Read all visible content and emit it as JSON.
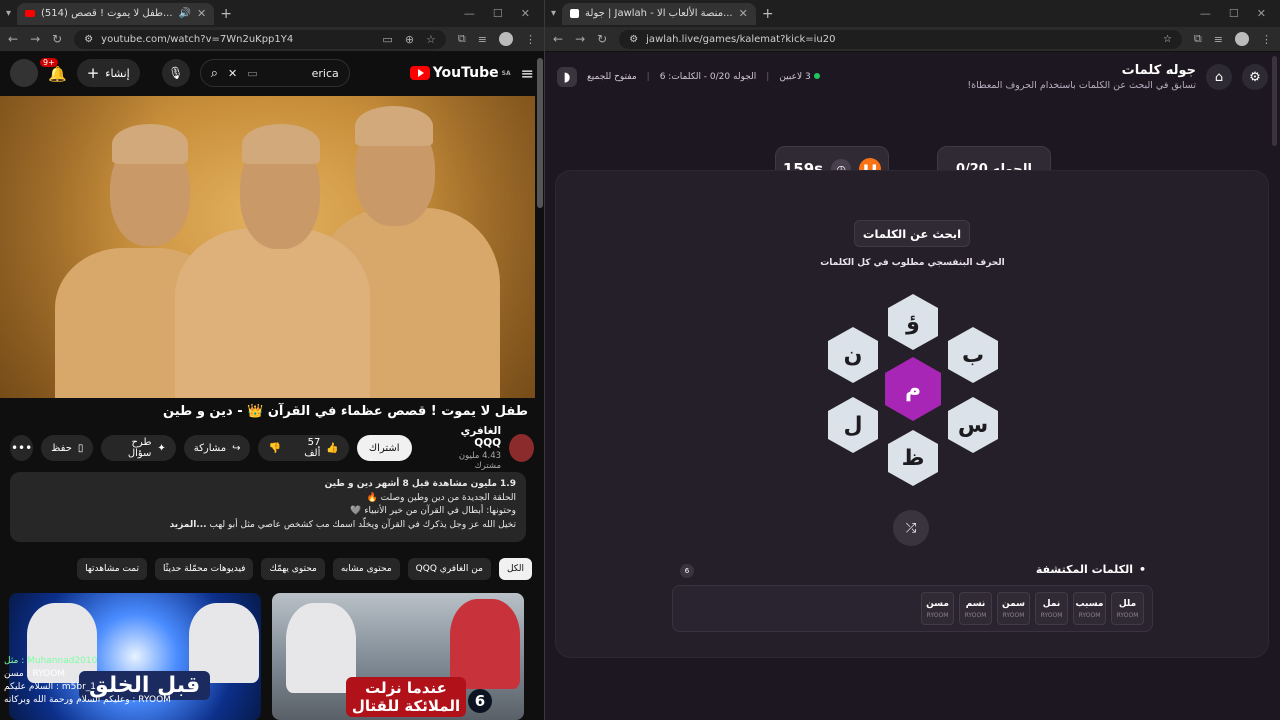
{
  "left_window": {
    "tab_title": "(514) طفل لا يموت ! قصص...",
    "url": "youtube.com/watch?v=7Wn2uKpp1Y4",
    "header": {
      "logo": "YouTube",
      "region": "SA",
      "search_value": "erica",
      "create_label": "إنشاء",
      "notif_count": "9+"
    },
    "video_title": "طفل لا يموت ! قصص عظماء في القرآن 👑 - دين و طين",
    "channel": {
      "name": "الغافري QQQ",
      "subs": "4.43 مليون مشترك",
      "subscribe_label": "اشتراك"
    },
    "actions": {
      "likes": "57 ألف",
      "share": "مشاركة",
      "ask": "طرح سؤال",
      "save": "حفظ"
    },
    "description": {
      "meta": "1.9 مليون مشاهدة  قبل 8 أشهر  دين و طين",
      "line1": "الحلقة الجديدة من دين وطين وصلت 🔥",
      "line2": "وحتونها: أبطال في القرآن من خير الأنبياء 🩶",
      "line3": "تخيل الله عز وجل يذكرك في القرآن ويخلّد اسمك مب كشخص عاصي مثل أبو لهب",
      "more": "...المزيد"
    },
    "chips": [
      "الكل",
      "من الغافري QQQ",
      "محتوى مشابه",
      "محتوى يهمّك",
      "فيديوهات محمّلة حديثًا",
      "تمت مشاهدتها"
    ],
    "thumbs": [
      {
        "title": "قبل الخلق"
      },
      {
        "title": "عندما نزلت الملائكة للقتال",
        "number": "6"
      }
    ],
    "chat": [
      "مثل : Muhannad2010",
      "مسن : RYOOM",
      "السلام عليكم : m5br_1",
      "وعليكم السلام ورحمة الله وبركاته : RYOOM"
    ]
  },
  "right_window": {
    "tab_title": "جولة | Jawlah - منصة الألعاب الا...",
    "url": "jawlah.live/games/kalemat?kick=iu20",
    "header": {
      "title": "جوله كلمات",
      "subtitle": "تسابق في البحث عن الكلمات باستخدام الحروف المعطاة!",
      "players": "3 لاعبين",
      "round_info": "الجوله 0/20 - الكلمات: 6",
      "open_label": "مفتوح للجميع"
    },
    "round_label": "الجوله 0/20",
    "timer": "159s",
    "task_label": "ابحث عن الكلمات",
    "hint": "الحرف البنفسجي مطلوب في كل الكلمات",
    "letters": {
      "top": "ؤ",
      "upper_left": "ن",
      "upper_right": "ب",
      "center": "م",
      "lower_left": "ل",
      "lower_right": "س",
      "bottom": "ظ"
    },
    "found_title": "الكلمات المكتشفة",
    "found_count": "6",
    "found_words": [
      {
        "word": "ملل",
        "by": "RYOOM"
      },
      {
        "word": "مسبب",
        "by": "RYOOM"
      },
      {
        "word": "نمل",
        "by": "RYOOM"
      },
      {
        "word": "سمن",
        "by": "RYOOM"
      },
      {
        "word": "نسم",
        "by": "RYOOM"
      },
      {
        "word": "مسن",
        "by": "RYOOM"
      }
    ]
  }
}
